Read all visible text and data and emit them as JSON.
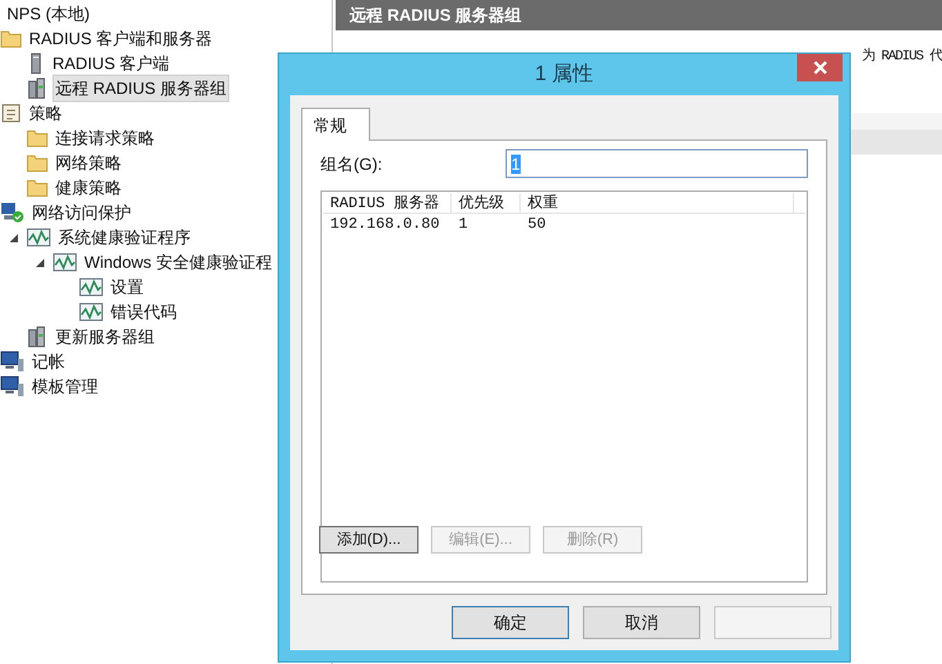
{
  "tree": [
    {
      "label": "NPS (本地)",
      "selected": false,
      "children": [
        {
          "label": "RADIUS 客户端和服务器",
          "kind": "folder",
          "selected": false,
          "children": [
            {
              "label": "RADIUS 客户端",
              "kind": "server",
              "selected": false
            },
            {
              "label": "远程 RADIUS 服务器组",
              "kind": "server-group",
              "selected": true
            }
          ]
        },
        {
          "label": "策略",
          "kind": "scroll",
          "selected": false,
          "children": [
            {
              "label": "连接请求策略",
              "kind": "folder",
              "selected": false
            },
            {
              "label": "网络策略",
              "kind": "folder",
              "selected": false
            },
            {
              "label": "健康策略",
              "kind": "folder",
              "selected": false
            }
          ]
        },
        {
          "label": "网络访问保护",
          "kind": "network",
          "selected": false,
          "children": [
            {
              "label": "系统健康验证程序",
              "kind": "chart",
              "selected": false,
              "expanded": true,
              "children": [
                {
                  "label": "Windows 安全健康验证程",
                  "kind": "chart",
                  "selected": false,
                  "expanded": true,
                  "children": [
                    {
                      "label": "设置",
                      "kind": "chart",
                      "selected": false
                    },
                    {
                      "label": "错误代码",
                      "kind": "chart",
                      "selected": false
                    }
                  ]
                }
              ]
            },
            {
              "label": "更新服务器组",
              "kind": "server-group",
              "selected": false
            }
          ]
        },
        {
          "label": "记帐",
          "kind": "computer",
          "selected": false
        },
        {
          "label": "模板管理",
          "kind": "computer",
          "selected": false
        }
      ]
    }
  ],
  "main": {
    "header": "远程 RADIUS 服务器组",
    "description": "为 RADIUS 代"
  },
  "dialog": {
    "title": "1 属性",
    "tabs": [
      {
        "label": "常规",
        "selected": true
      }
    ],
    "group_name": {
      "label": "组名(G):",
      "value": "1"
    },
    "table": {
      "columns": [
        "RADIUS 服务器",
        "优先级",
        "权重"
      ],
      "rows": [
        [
          "192.168.0.80",
          "1",
          "50"
        ]
      ]
    },
    "list_buttons": [
      {
        "label": "添加(D)...",
        "disabled": false
      },
      {
        "label": "编辑(E)...",
        "disabled": true
      },
      {
        "label": "删除(R)",
        "disabled": true
      }
    ],
    "buttons": [
      {
        "label": "确定"
      },
      {
        "label": "取消"
      }
    ]
  }
}
